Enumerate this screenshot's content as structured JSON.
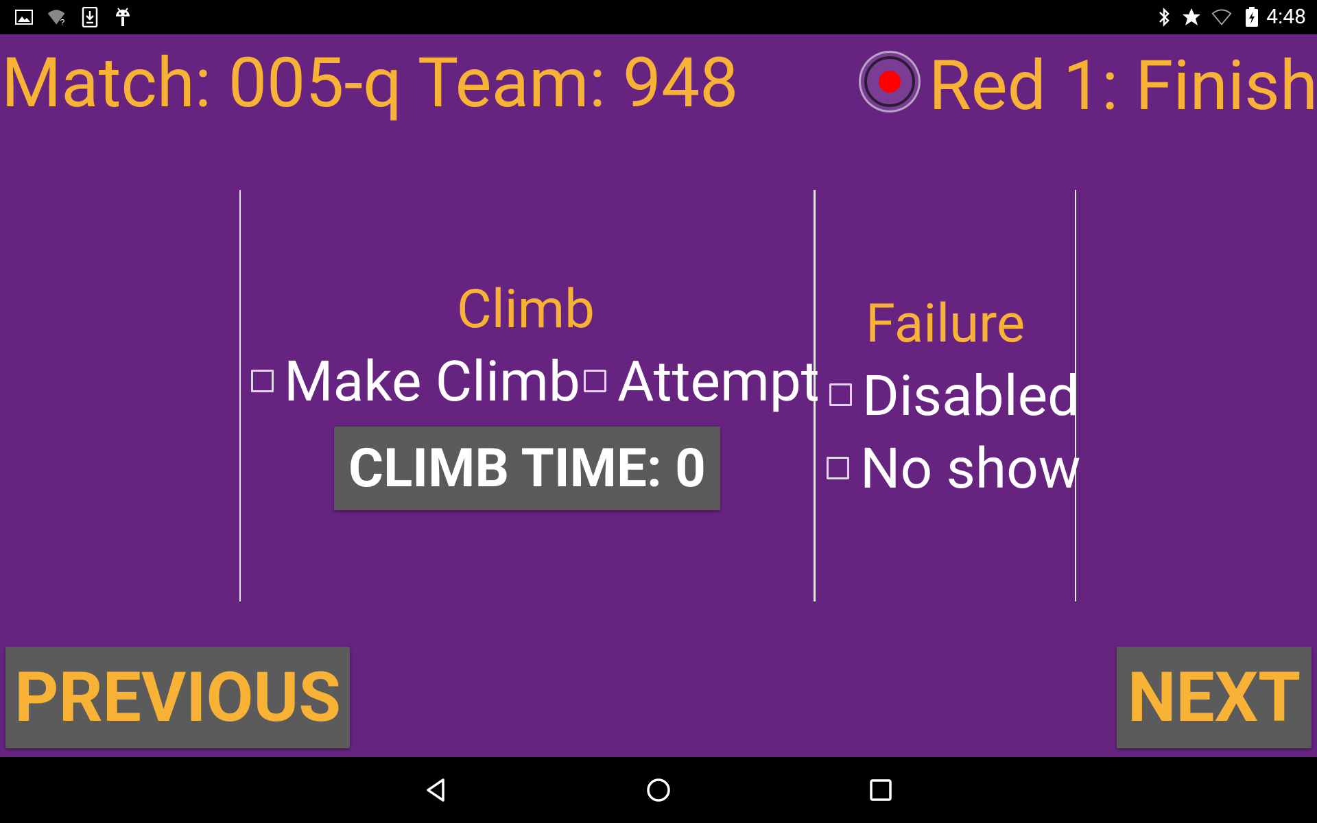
{
  "status_bar": {
    "left_icons": [
      "image-icon",
      "wifi-unknown-icon",
      "download-icon",
      "android-debug-icon"
    ],
    "right_icons": [
      "bluetooth-icon",
      "star-icon",
      "wifi-icon",
      "battery-charging-icon"
    ],
    "time": "4:48"
  },
  "header": {
    "match_team": "Match: 005-q Team: 948",
    "position_status": "Red 1: Finish",
    "recording_dot_color": "#FF0000"
  },
  "climb": {
    "title": "Climb",
    "make_climb_label": "Make Climb",
    "make_climb_checked": false,
    "attempt_label": "Attempt",
    "attempt_checked": false,
    "climb_time_label": "CLIMB TIME: 0"
  },
  "failure": {
    "title": "Failure",
    "disabled_label": "Disabled",
    "disabled_checked": false,
    "no_show_label": "No show",
    "no_show_checked": false
  },
  "navigation": {
    "previous_label": "PREVIOUS",
    "next_label": "NEXT"
  },
  "system_nav": [
    "back-icon",
    "home-icon",
    "recents-icon"
  ],
  "colors": {
    "background": "#66237F",
    "accent_text": "#F8B236",
    "button_bg": "#5B5B5B"
  }
}
